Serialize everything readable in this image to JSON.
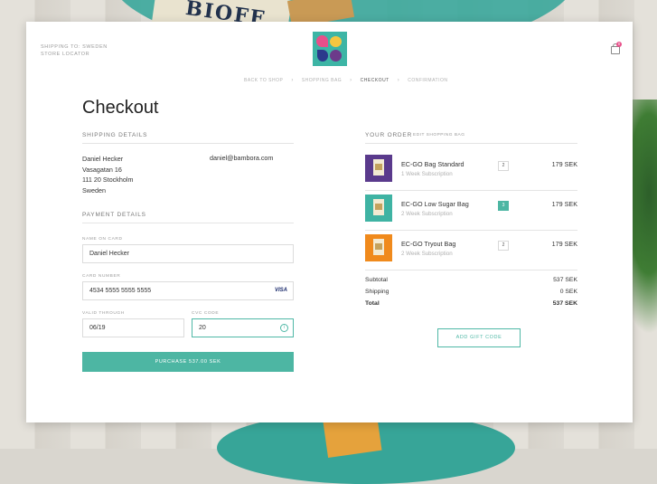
{
  "background": {
    "bag_text": "BIOFF"
  },
  "header": {
    "shipping_to": "SHIPPING TO: SWEDEN",
    "store_locator": "STORE LOCATOR",
    "logo_text": "EC GO",
    "bag_count": "0"
  },
  "breadcrumb": {
    "items": [
      "BACK TO SHOP",
      "SHOPPING BAG",
      "CHECKOUT",
      "CONFIRMATION"
    ],
    "separator": "›"
  },
  "page_title": "Checkout",
  "shipping": {
    "heading": "SHIPPING DETAILS",
    "name": "Daniel Hecker",
    "street": "Vasagatan 16",
    "city": "111 20 Stockholm",
    "country": "Sweden",
    "email": "daniel@bambora.com"
  },
  "payment": {
    "heading": "PAYMENT DETAILS",
    "name_label": "NAME ON CARD",
    "name_value": "Daniel Hecker",
    "card_label": "CARD NUMBER",
    "card_value": "4534 5555 5555 5555",
    "card_brand": "VISA",
    "valid_label": "VALID THROUGH",
    "valid_value": "06/19",
    "cvc_label": "CVC CODE",
    "cvc_value": "20",
    "info_glyph": "i",
    "purchase_label": "PURCHASE 537.00 SEK"
  },
  "order": {
    "heading": "YOUR ORDER",
    "edit_label": "EDIT SHOPPING BAG",
    "items": [
      {
        "name": "EC-GO Bag Standard",
        "sub": "1 Week Subscription",
        "qty": "2",
        "price": "179 SEK",
        "color": "#5a3a8c"
      },
      {
        "name": "EC-GO Low Sugar Bag",
        "sub": "2 Week Subscription",
        "qty": "3",
        "price": "179 SEK",
        "color": "#3fb3a3"
      },
      {
        "name": "EC-GO Tryout Bag",
        "sub": "2 Week Subscription",
        "qty": "2",
        "price": "179 SEK",
        "color": "#f08a1c"
      }
    ],
    "subtotal_label": "Subtotal",
    "subtotal_value": "537 SEK",
    "shipping_label": "Shipping",
    "shipping_value": "0 SEK",
    "total_label": "Total",
    "total_value": "537 SEK",
    "gift_label": "ADD GIFT CODE"
  },
  "colors": {
    "accent": "#4db6a3",
    "text": "#333333"
  }
}
